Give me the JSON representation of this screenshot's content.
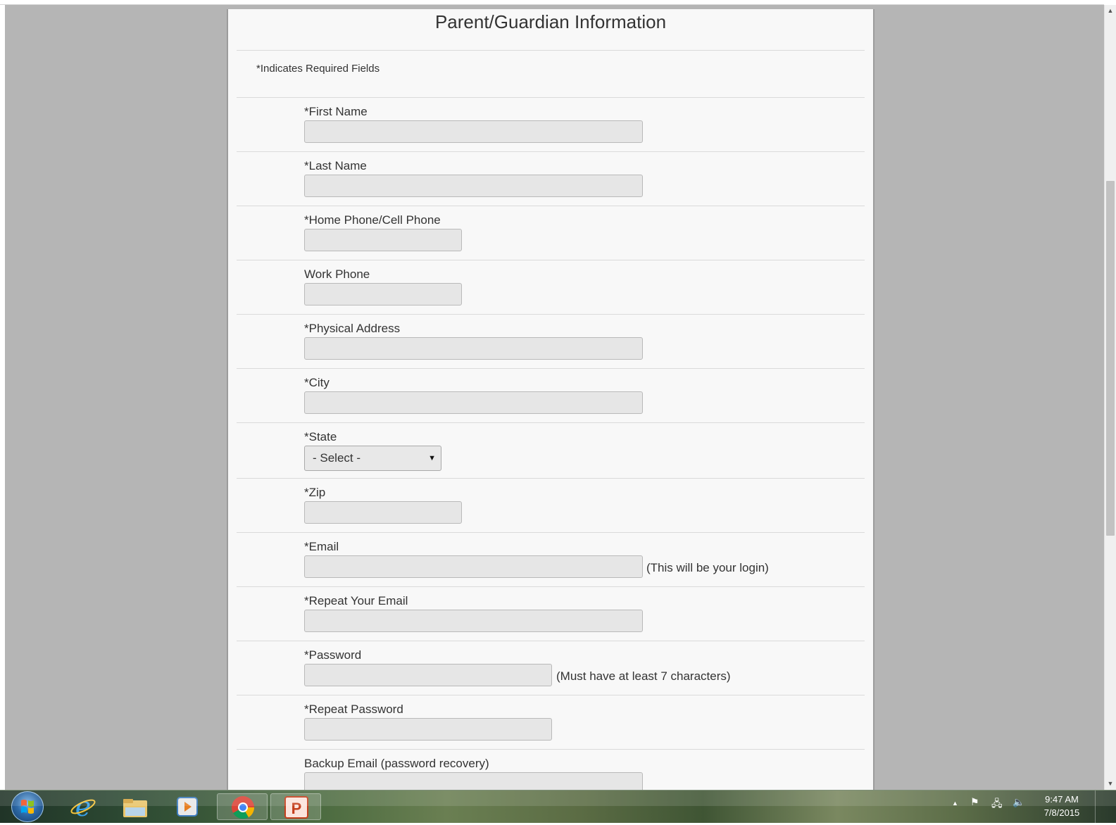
{
  "form": {
    "title": "Parent/Guardian Information",
    "required_note": "*Indicates Required Fields",
    "fields": {
      "first_name": {
        "label": "*First Name"
      },
      "last_name": {
        "label": "*Last Name"
      },
      "home_phone": {
        "label": "*Home Phone/Cell Phone"
      },
      "work_phone": {
        "label": "Work Phone"
      },
      "address": {
        "label": "*Physical Address"
      },
      "city": {
        "label": "*City"
      },
      "state": {
        "label": "*State",
        "selected": "- Select -"
      },
      "zip": {
        "label": "*Zip"
      },
      "email": {
        "label": "*Email",
        "hint": "(This will be your login)"
      },
      "repeat_email": {
        "label": "*Repeat Your Email"
      },
      "password": {
        "label": "*Password",
        "hint": "(Must have at least 7 characters)"
      },
      "repeat_password": {
        "label": "*Repeat Password"
      },
      "backup_email": {
        "label": "Backup Email (password recovery)"
      }
    }
  },
  "taskbar": {
    "clock": {
      "time": "9:47 AM",
      "date": "7/8/2015"
    },
    "apps": [
      "internet-explorer",
      "file-explorer",
      "media-player",
      "chrome",
      "powerpoint"
    ]
  },
  "glyphs": {
    "dropdown_arrow": "▼",
    "scroll_up": "▲",
    "scroll_down": "▼",
    "tray_up": "▲",
    "flag": "⚑",
    "network": "🖧",
    "volume": "🔈"
  }
}
